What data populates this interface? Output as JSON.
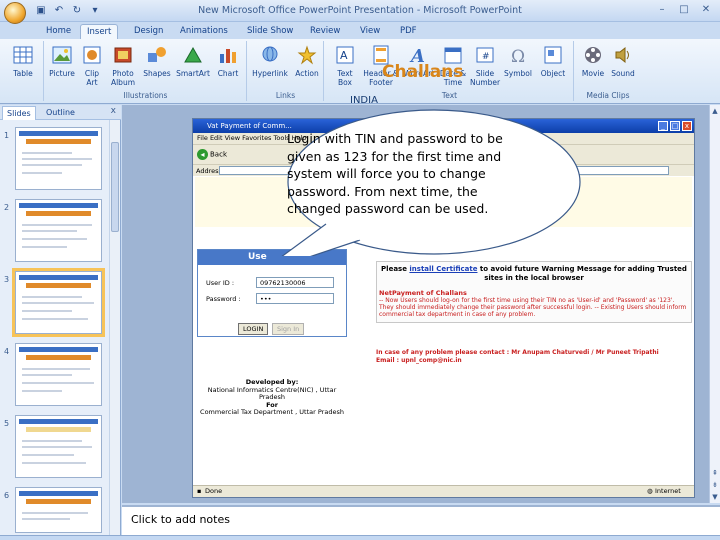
{
  "window": {
    "title": "New Microsoft Office PowerPoint Presentation - Microsoft PowerPoint",
    "controls": [
      "–",
      "□",
      "✕"
    ]
  },
  "ribbon": {
    "tabs": [
      "Home",
      "Insert",
      "Design",
      "Animations",
      "Slide Show",
      "Review",
      "View",
      "PDF"
    ],
    "active_tab": "Insert",
    "groups": {
      "tables": {
        "label": "",
        "buttons": [
          "Table"
        ]
      },
      "illustrations": {
        "label": "Illustrations",
        "buttons": [
          "Picture",
          "Clip Art",
          "Photo Album",
          "Shapes",
          "SmartArt",
          "Chart"
        ]
      },
      "links": {
        "label": "Links",
        "buttons": [
          "Hyperlink",
          "Action"
        ]
      },
      "text": {
        "label": "Text",
        "buttons": [
          "Text Box",
          "Header & Footer",
          "WordArt",
          "Date & Time",
          "Slide Number",
          "Symbol",
          "Object"
        ]
      },
      "media": {
        "label": "Media Clips",
        "buttons": [
          "Movie",
          "Sound"
        ]
      }
    }
  },
  "slides_panel": {
    "tabs": [
      "Slides",
      "Outline"
    ],
    "close": "x",
    "slide_numbers": [
      "1",
      "2",
      "3",
      "4",
      "5",
      "6"
    ],
    "selected": 3
  },
  "browser": {
    "title": "Vat Payment of Comm...",
    "menu": "File  Edit  View  Favorites  Tools  Help",
    "back": "Back",
    "address_label": "Address",
    "status_done": "Done",
    "status_zone": "Internet"
  },
  "page": {
    "heading": "Challans",
    "subheading": "INDIA",
    "login_header": "Use",
    "user_id_label": "User ID :",
    "user_id_value": "09762130006",
    "password_label": "Password :",
    "password_value": "•••",
    "login_button": "LOGIN",
    "signin_button": "Sign In",
    "developed_by": "Developed by:",
    "developer": "National Informatics Centre(NIC) , Uttar Pradesh",
    "for": "For",
    "department": "Commercial Tax Department , Uttar Pradesh",
    "cert_prefix": "Please ",
    "cert_link": "install Certificate",
    "cert_suffix": " to avoid future Warning Message for adding Trusted sites in the local browser",
    "notice_title": "NetPayment of Challans",
    "notice_body": "-- Now Users should log-on for the first time using their TIN no as 'User-id' and 'Password' as '123'. They should immediately change their password after successful login. -- Existing Users should inform commercial tax department in case of any problem.",
    "contact": "In case of any problem please contact : Mr Anupam Chaturvedi / Mr Puneet Tripathi",
    "email": "Email : upnl_comp@nic.in"
  },
  "callout": {
    "text": "Login with TIN and password to be given as 123 for the first time and system will force you to change password. From next time, the changed password can be used."
  },
  "notes": {
    "placeholder": "Click to add notes"
  },
  "colors": {
    "ribbon_bg": "#d6e5f6",
    "callout_fill": "#ffffff",
    "selection": "#f7c358",
    "challans_orange": "#d9861a",
    "login_blue": "#4878c8"
  }
}
